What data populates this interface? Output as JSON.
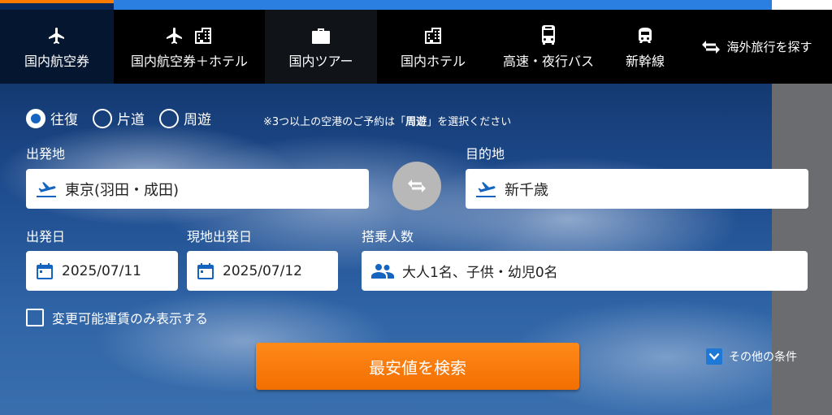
{
  "nav": {
    "tabs": [
      {
        "label": "国内航空券",
        "icons": [
          "airplane-icon"
        ]
      },
      {
        "label": "国内航空券＋ホテル",
        "icons": [
          "airplane-icon",
          "hotel-icon"
        ]
      },
      {
        "label": "国内ツアー",
        "icons": [
          "suitcase-icon"
        ]
      },
      {
        "label": "国内ホテル",
        "icons": [
          "hotel-icon"
        ]
      },
      {
        "label": "高速・夜行バス",
        "icons": [
          "bus-icon"
        ]
      },
      {
        "label": "新幹線",
        "icons": [
          "train-icon"
        ]
      },
      {
        "label": "海外旅行を探す",
        "icons": [
          "swap-arrows-icon"
        ]
      }
    ],
    "active_tab": "国内航空券",
    "active_color": "#ff7a00"
  },
  "trip_type": {
    "options": [
      "往復",
      "片道",
      "周遊"
    ],
    "selected": "往復",
    "note_prefix": "※3つ以上の空港のご予約は「",
    "note_bold": "周遊",
    "note_suffix": "」を選択ください"
  },
  "origin": {
    "label": "出発地",
    "value": "東京(羽田・成田)"
  },
  "destination": {
    "label": "目的地",
    "value": "新千歳"
  },
  "departure_date": {
    "label": "出発日",
    "value": "2025/07/11"
  },
  "return_date": {
    "label": "現地出発日",
    "value": "2025/07/12"
  },
  "passengers": {
    "label": "搭乗人数",
    "value": "大人1名、子供・幼児0名"
  },
  "flexible_fare": {
    "label": "変更可能運賃のみ表示する",
    "checked": false
  },
  "search_button": {
    "label": "最安値を検索",
    "color": "#f57a00"
  },
  "other_conditions": {
    "label": "その他の条件",
    "checked": true
  }
}
